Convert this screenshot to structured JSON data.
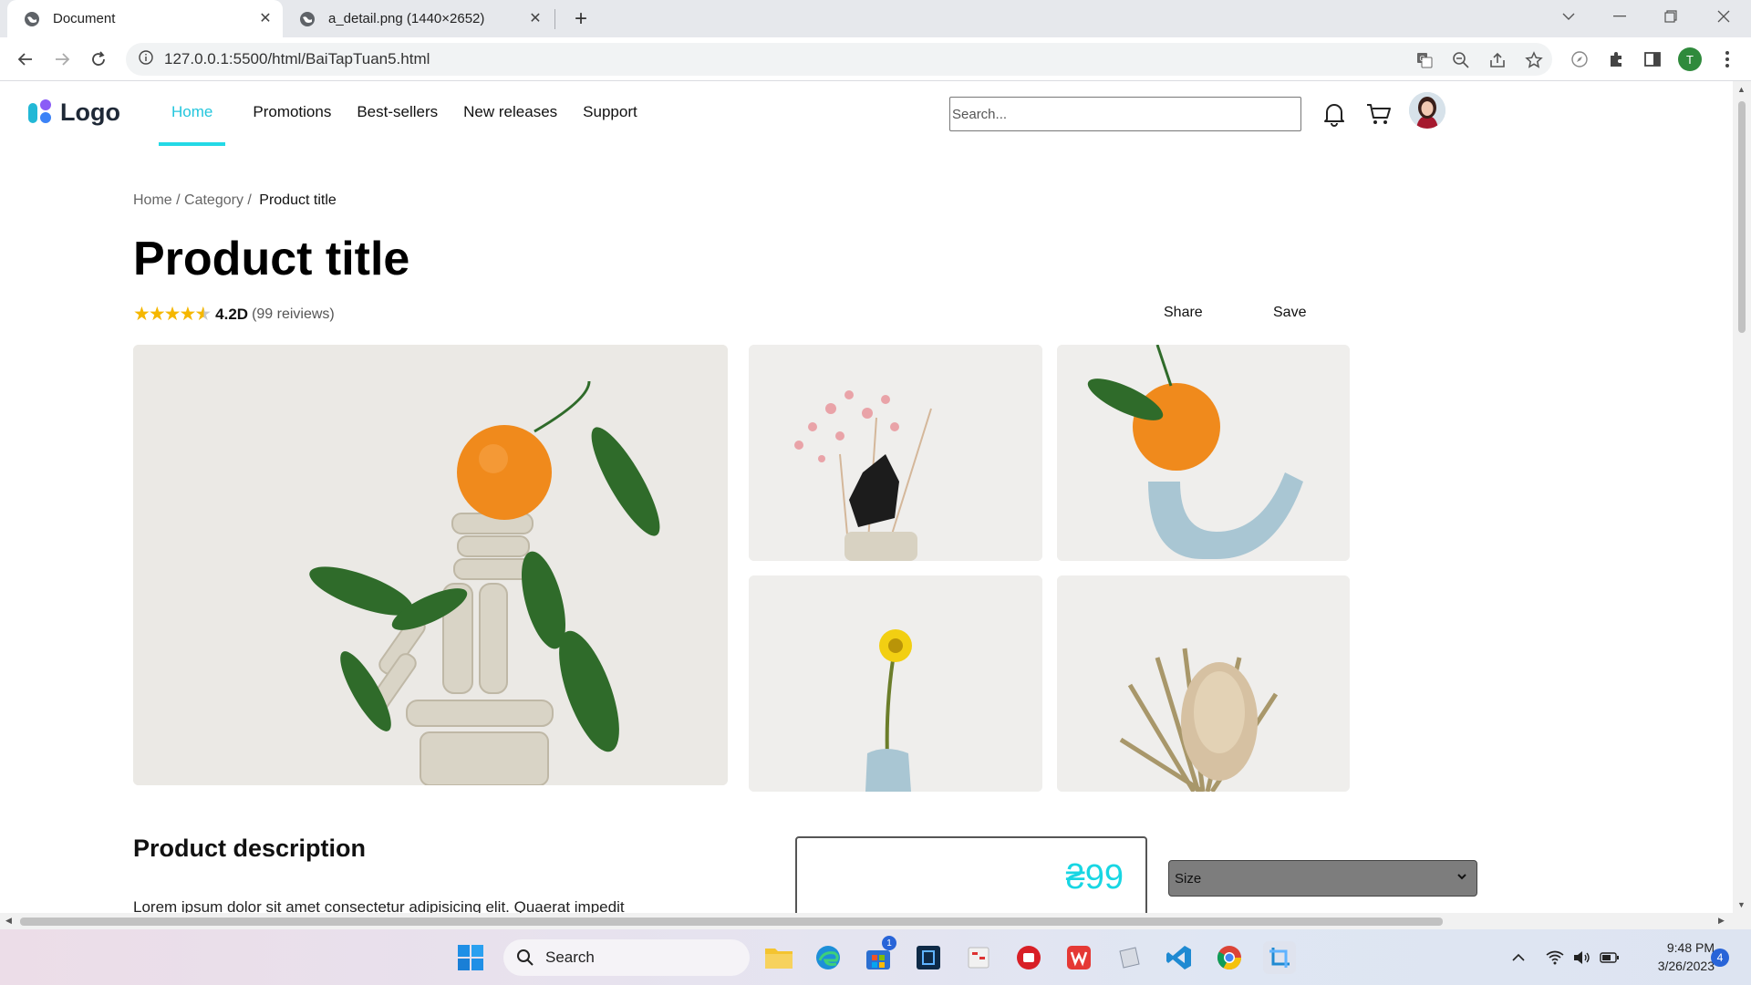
{
  "browser": {
    "tabs": [
      {
        "title": "Document",
        "active": true
      },
      {
        "title": "a_detail.png (1440×2652)",
        "active": false
      }
    ],
    "url": "127.0.0.1:5500/html/BaiTapTuan5.html",
    "profile_initial": "T"
  },
  "site": {
    "logo_text": "Logo",
    "nav": [
      {
        "label": "Home",
        "active": true
      },
      {
        "label": "Promotions",
        "active": false
      },
      {
        "label": "Best-sellers",
        "active": false
      },
      {
        "label": "New releases",
        "active": false
      },
      {
        "label": "Support",
        "active": false
      }
    ],
    "search_placeholder": "Search..."
  },
  "product": {
    "breadcrumb": {
      "path": "Home / Category / ",
      "current": "Product title"
    },
    "title": "Product title",
    "rating_value": "4.2D",
    "rating_count": "(99 reiviews)",
    "stars": 4.5,
    "share_label": "Share",
    "save_label": "Save",
    "images": [
      "orange-on-clay-sculpture",
      "dried-pink-flowers-on-black-stone",
      "orange-on-blue-clay",
      "yellow-flower-in-blue-vase",
      "dried-protea-bouquet"
    ],
    "description_title": "Product description",
    "description_text": "Lorem ipsum dolor sit amet consectetur adipisicing elit. Quaerat impedit",
    "price": "₴99",
    "size_label": "Size"
  },
  "taskbar": {
    "search_label": "Search",
    "time": "9:48 PM",
    "date": "3/26/2023",
    "notification_count": "4",
    "store_badge": "1"
  }
}
